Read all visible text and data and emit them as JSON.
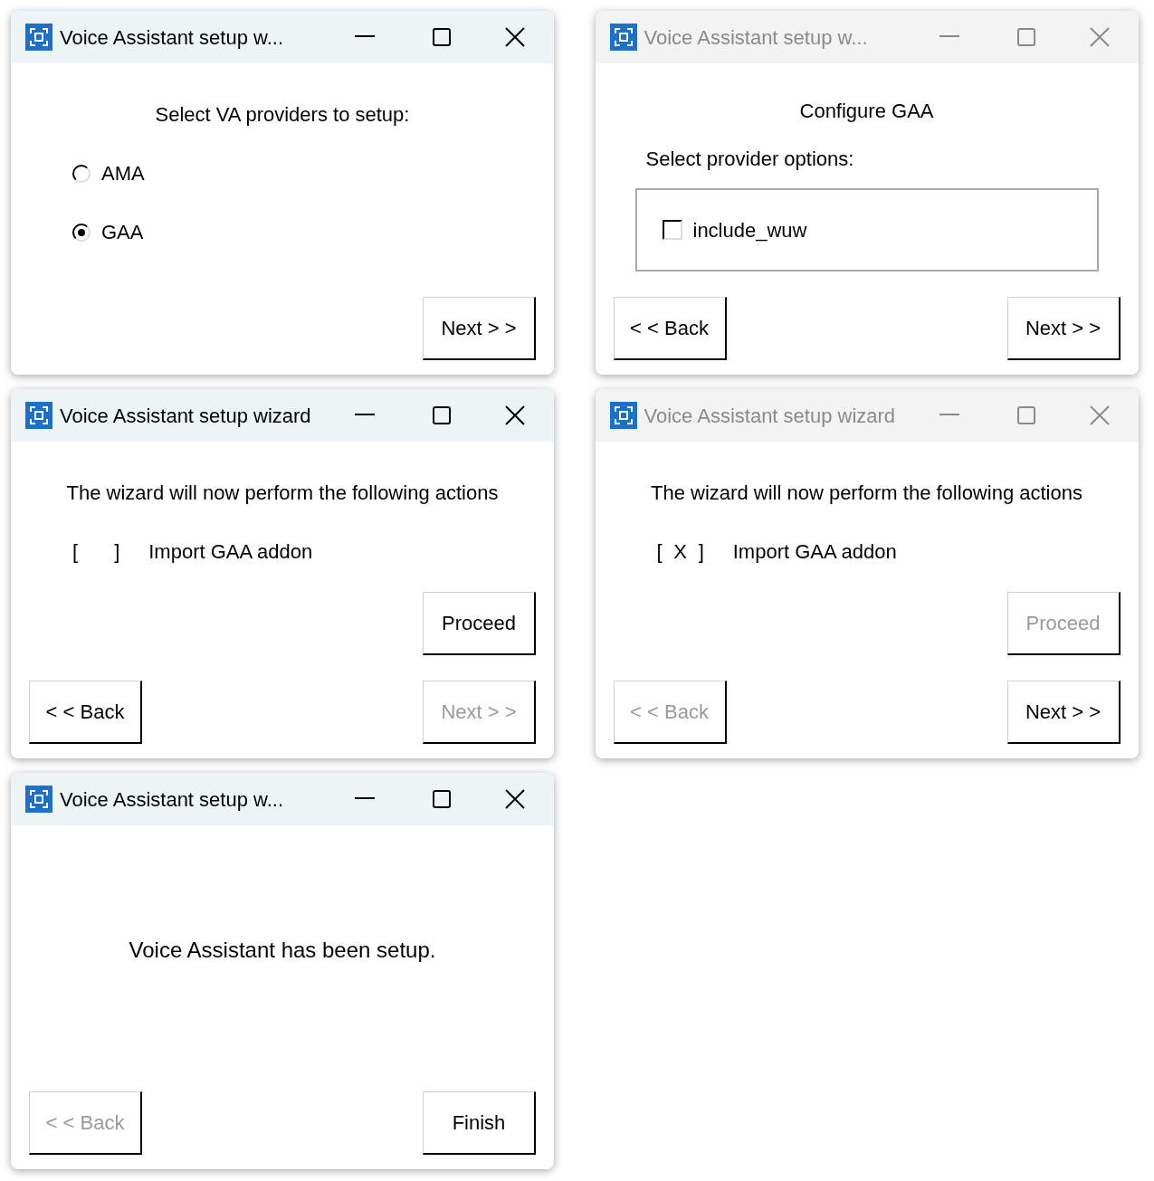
{
  "windows": [
    {
      "kind": "providers",
      "title": "Voice Assistant setup w...",
      "active": true,
      "heading": "Select VA providers to setup:",
      "options": [
        {
          "label": "AMA",
          "selected": false
        },
        {
          "label": "GAA",
          "selected": true
        }
      ],
      "button_rows": [
        [
          {
            "label": "Next > >",
            "disabled": false
          }
        ]
      ]
    },
    {
      "kind": "options",
      "title": "Voice Assistant setup w...",
      "active": false,
      "heading": "Configure GAA",
      "subheading": "Select provider options:",
      "options": [
        {
          "label": "include_wuw",
          "checked": false
        }
      ],
      "button_rows": [
        [
          {
            "label": "< < Back",
            "disabled": false
          },
          {
            "label": "Next > >",
            "disabled": false
          }
        ]
      ]
    },
    {
      "kind": "actions",
      "title": "Voice Assistant setup wizard",
      "active": true,
      "heading": "The wizard will now perform the following actions",
      "actions": [
        {
          "open": "[",
          "close": "]",
          "label": "Import GAA addon"
        }
      ],
      "button_rows": [
        [
          {
            "label": "Proceed",
            "disabled": false
          }
        ],
        [
          {
            "label": "< < Back",
            "disabled": false
          },
          {
            "label": "Next > >",
            "disabled": true
          }
        ]
      ]
    },
    {
      "kind": "actions",
      "title": "Voice Assistant setup wizard",
      "active": false,
      "heading": "The wizard will now perform the following actions",
      "actions": [
        {
          "open": "[",
          "close": "]",
          "check": "X",
          "label": "Import GAA addon"
        }
      ],
      "button_rows": [
        [
          {
            "label": "Proceed",
            "disabled": true
          }
        ],
        [
          {
            "label": "< < Back",
            "disabled": true
          },
          {
            "label": "Next > >",
            "disabled": false
          }
        ]
      ]
    },
    {
      "kind": "done",
      "title": "Voice Assistant setup w...",
      "active": true,
      "heading": "Voice Assistant has been setup.",
      "button_rows": [
        [
          {
            "label": "< < Back",
            "disabled": true
          },
          {
            "label": "Finish",
            "disabled": false
          }
        ]
      ]
    }
  ]
}
